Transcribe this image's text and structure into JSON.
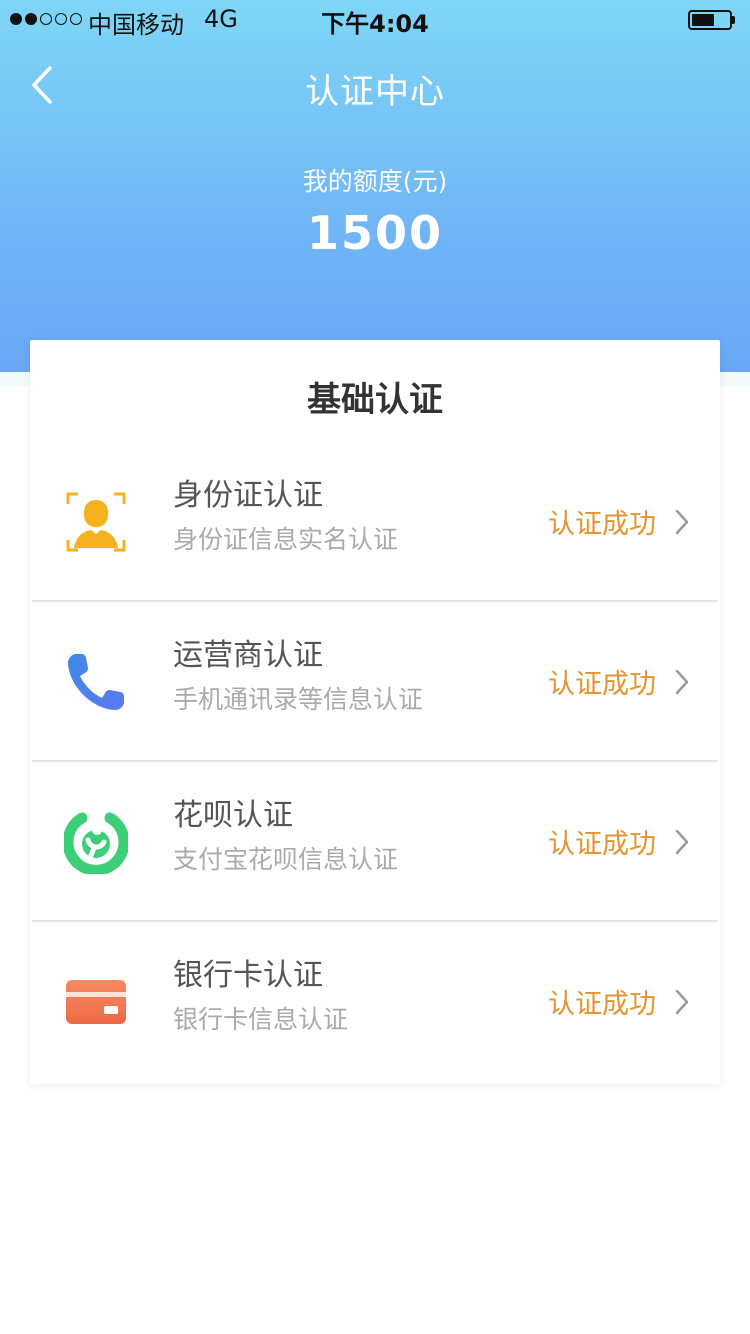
{
  "status_bar": {
    "carrier": "中国移动",
    "network": "4G",
    "time": "下午4:04",
    "signal_bars_filled": 2,
    "signal_bars_total": 5,
    "battery_level": 0.6
  },
  "nav": {
    "title": "认证中心",
    "back_icon": "chevron-left-icon"
  },
  "quota": {
    "label": "我的额度(元)",
    "value": "1500"
  },
  "card": {
    "title": "基础认证",
    "items": [
      {
        "title": "身份证认证",
        "subtitle": "身份证信息实名认证",
        "status": "认证成功",
        "icon": "id-card-person-icon"
      },
      {
        "title": "运营商认证",
        "subtitle": "手机通讯录等信息认证",
        "status": "认证成功",
        "icon": "phone-icon"
      },
      {
        "title": "花呗认证",
        "subtitle": "支付宝花呗信息认证",
        "status": "认证成功",
        "icon": "huabei-icon"
      },
      {
        "title": "银行卡认证",
        "subtitle": "银行卡信息认证",
        "status": "认证成功",
        "icon": "bank-card-icon"
      }
    ]
  },
  "colors": {
    "header_top": "#7fd6f6",
    "header_bottom": "#6aa8f6",
    "status_text": "#e8922e",
    "id_icon": "#f5b120",
    "phone_icon": "#4a86e8",
    "huabei_icon": "#3dcf78",
    "bank_icon": "#f07a52"
  }
}
